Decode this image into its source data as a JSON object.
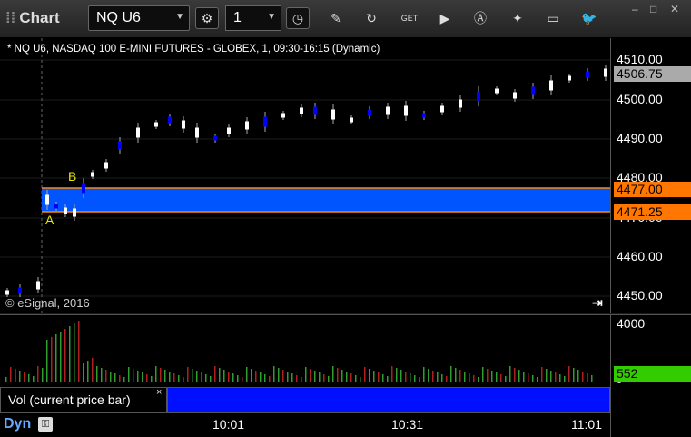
{
  "window": {
    "title": "Chart",
    "symbol": "NQ U6",
    "interval": "1",
    "controls": {
      "minimize": "–",
      "restore": "□",
      "close": "✕"
    }
  },
  "toolbar_icons": [
    "settings-icon",
    "pencil-icon",
    "refresh-icon",
    "get-icon",
    "play-icon",
    "alert-icon",
    "tools-icon",
    "comment-icon",
    "twitter-icon"
  ],
  "chart": {
    "description": "* NQ U6, NASDAQ 100 E-MINI FUTURES - GLOBEX, 1, 09:30-16:15 (Dynamic)",
    "copyright": "© eSignal, 2016",
    "scroll_to_end": "⇥",
    "price_ticks": [
      "4510.00",
      "4500.00",
      "4490.00",
      "4480.00",
      "4470.00",
      "4460.00",
      "4450.00"
    ],
    "last_price": "4506.75",
    "zone_upper_label": "4477.00",
    "zone_lower_label": "4471.25",
    "point_a": "A",
    "point_b": "B",
    "volume_ticks": [
      "4000",
      "0"
    ],
    "volume_last": "552",
    "volume_legend": "Vol (current price bar)",
    "volume_legend_close": "×",
    "time_ticks": [
      "10:01",
      "10:31",
      "11:01"
    ],
    "mode": "Dyn",
    "mode_icon": "lock-icon"
  },
  "colors": {
    "zone": "#0055ff",
    "zone_line": "#ff8800",
    "up_candle": "#ffffff",
    "down_candle": "#0000ff",
    "last_price_bg": "#aaaaaa",
    "zone_label_bg": "#ff7700",
    "volume_label_bg": "#33cc00",
    "vol_up": "#2f9e2f",
    "vol_down": "#b02020"
  }
}
